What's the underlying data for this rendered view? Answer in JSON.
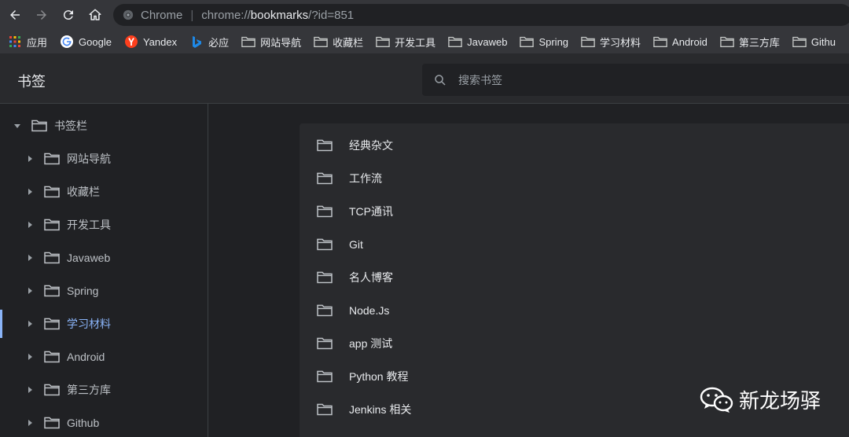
{
  "browser": {
    "omnibox_origin": "Chrome",
    "url_prefix": "chrome://",
    "url_host": "bookmarks",
    "url_path": "/?id=851"
  },
  "bookmarks_bar": [
    {
      "label": "应用",
      "icon": "apps-grid-icon"
    },
    {
      "label": "Google",
      "icon": "google-icon"
    },
    {
      "label": "Yandex",
      "icon": "yandex-icon"
    },
    {
      "label": "必应",
      "icon": "bing-icon"
    },
    {
      "label": "网站导航",
      "icon": "folder-icon"
    },
    {
      "label": "收藏栏",
      "icon": "folder-icon"
    },
    {
      "label": "开发工具",
      "icon": "folder-icon"
    },
    {
      "label": "Javaweb",
      "icon": "folder-icon"
    },
    {
      "label": "Spring",
      "icon": "folder-icon"
    },
    {
      "label": "学习材料",
      "icon": "folder-icon"
    },
    {
      "label": "Android",
      "icon": "folder-icon"
    },
    {
      "label": "第三方库",
      "icon": "folder-icon"
    },
    {
      "label": "Githu",
      "icon": "folder-icon"
    }
  ],
  "header": {
    "title": "书签",
    "search_placeholder": "搜索书签"
  },
  "sidebar": {
    "root": "书签栏",
    "items": [
      "网站导航",
      "收藏栏",
      "开发工具",
      "Javaweb",
      "Spring",
      "学习材料",
      "Android",
      "第三方库",
      "Github"
    ],
    "selected": "学习材料"
  },
  "main_list": [
    "经典杂文",
    "工作流",
    "TCP通讯",
    "Git",
    "名人博客",
    "Node.Js",
    "app 测试",
    "Python 教程",
    "Jenkins 相关"
  ],
  "watermark": "新龙场驿",
  "colors": {
    "accent": "#8ab4f8",
    "background": "#202124",
    "surface": "#292a2d",
    "toolbar": "#35363a"
  }
}
